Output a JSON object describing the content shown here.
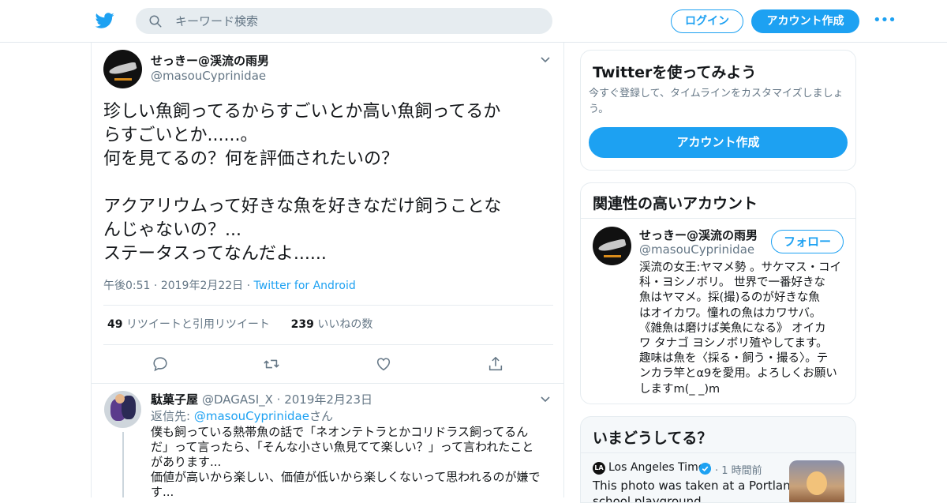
{
  "header": {
    "search_placeholder": "キーワード検索",
    "login_label": "ログイン",
    "signup_label": "アカウント作成",
    "more_label": "•••",
    "brand_color": "#1da1f2"
  },
  "tweet": {
    "author_name": "せっきー@渓流の雨男",
    "author_handle": "@masouCyprinidae",
    "text_lines": [
      "珍しい魚飼ってるからすごいとか高い魚飼ってるか",
      "らすごいとか......。",
      "何を見てるの？何を評価されたいの？",
      "",
      "アクアリウムって好きな魚を好きなだけ飼うことな",
      "んじゃないの？...",
      "ステータスってなんだよ......"
    ],
    "time": "午後0:51",
    "date": "2019年2月22日",
    "source": "Twitter for Android",
    "retweets_count": "49",
    "retweets_label": "リツイートと引用リツイート",
    "likes_count": "239",
    "likes_label": "いいねの数",
    "actions": [
      "reply-icon",
      "retweet-icon",
      "like-icon",
      "share-icon"
    ]
  },
  "reply": {
    "author_name": "駄菓子屋",
    "author_handle": "@DAGASI_X",
    "date": "2019年2月23日",
    "reply_to_prefix": "返信先:",
    "reply_to_handle": "@masouCyprinidae",
    "reply_to_suffix": "さん",
    "text_lines": [
      "僕も飼っている熱帯魚の話で「ネオンテトラとかコリドラス飼ってるん",
      "だ」って言ったら、「そんな小さい魚見てて楽しい？」って言われたこと",
      "があります...",
      "価値が高いから楽しい、価値が低いから楽しくないって思われるのが嫌で",
      "す..."
    ]
  },
  "sidebar": {
    "signup_card": {
      "title": "Twitterを使ってみよう",
      "desc_lines": [
        "今すぐ登録して、タイムラインをカスタマイズしましょ",
        "う。"
      ],
      "button_label": "アカウント作成"
    },
    "related_card": {
      "title": "関連性の高いアカウント",
      "name": "せっきー@渓流の雨男",
      "handle": "@masouCyprinidae",
      "follow_label": "フォロー",
      "bio_lines": [
        "渓流の女王:ヤマメ勢 。サケマス・コイ",
        "科・ヨシノボリ。 世界で一番好きな",
        "魚はヤマメ。採(撮)るのが好きな魚",
        "はオイカワ。憧れの魚はカワサバ。",
        "《雑魚は磨けば美魚になる》 オイカ",
        "ワ タナゴ ヨシノボリ殖やしてます。",
        "趣味は魚を〈採る・飼う・撮る〉。テ",
        "ンカラ竿とα9を愛用。よろしくお願い",
        "しますm(_ _)m"
      ]
    },
    "trends_card": {
      "title": "いまどうしてる？",
      "source": "Los Angeles Times",
      "source_logo": "LA",
      "ago": "1 時間前",
      "headline_lines": [
        "This photo was taken at a Portland",
        "school playground..."
      ]
    }
  }
}
